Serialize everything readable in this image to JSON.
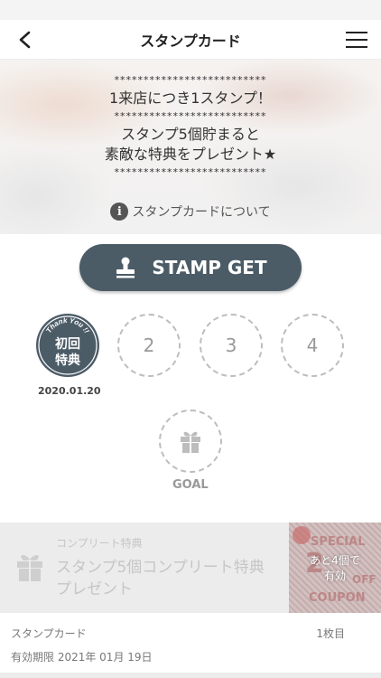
{
  "nav": {
    "title": "スタンプカード",
    "back_icon": "chevron-left-icon",
    "menu_icon": "hamburger-menu-icon"
  },
  "hero": {
    "stars": "**************************",
    "line1": "1来店につき1スタンプ！",
    "line2": "スタンプ5個貯まると",
    "line3": "素敵な特典をプレゼント★",
    "about_link": "スタンプカードについて",
    "info_icon_glyph": "i"
  },
  "stamp_button": {
    "label": "STAMP GET",
    "icon": "stamp-icon"
  },
  "stamps": [
    {
      "status": "done",
      "badge_arc": "Thank You !!",
      "badge_line1": "初回",
      "badge_line2": "特典",
      "date": "2020.01.20"
    },
    {
      "status": "empty",
      "number": "2"
    },
    {
      "status": "empty",
      "number": "3"
    },
    {
      "status": "empty",
      "number": "4"
    },
    {
      "status": "goal",
      "label": "GOAL",
      "icon": "gift-icon"
    }
  ],
  "complete": {
    "caption": "コンプリート特典",
    "title_line1": "スタンプ5個コンプリート特典",
    "title_line2": "プレゼント",
    "coupon": {
      "special": "SPECIAL",
      "number": "2",
      "off": "OFF",
      "coupon": "COUPON",
      "remain_line1": "あと4個で",
      "remain_line2": "有効"
    }
  },
  "footer": {
    "card_label": "スタンプカード",
    "count": "1枚目",
    "expiry": "有効期限 2021年 01月 19日"
  },
  "colors": {
    "accent": "#4c5c67",
    "dashed": "#bdbdbd",
    "coupon_pink": "#d79a9a"
  }
}
